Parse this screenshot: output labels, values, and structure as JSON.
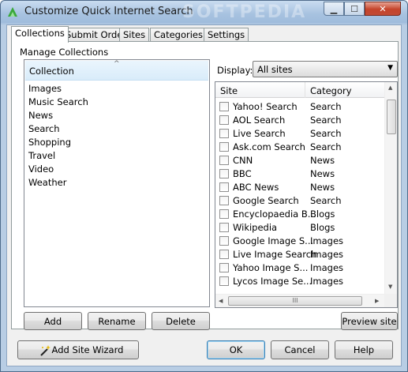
{
  "window": {
    "title": "Customize Quick Internet Search",
    "watermark": "SOFTPEDIA",
    "minimize_glyph": "▁",
    "maximize_glyph": "☐",
    "close_glyph": "✕"
  },
  "tabs": [
    {
      "label": "Collections",
      "active": true
    },
    {
      "label": "Submit Order",
      "active": false
    },
    {
      "label": "Sites",
      "active": false
    },
    {
      "label": "Categories",
      "active": false
    },
    {
      "label": "Settings",
      "active": false
    }
  ],
  "manage": {
    "group_label": "Manage Collections",
    "list_header": "Collection",
    "sort_glyph": "^",
    "collections": [
      "Images",
      "Music Search",
      "News",
      "Search",
      "Shopping",
      "Travel",
      "Video",
      "Weather"
    ],
    "buttons": {
      "add": "Add",
      "rename": "Rename",
      "delete": "Delete"
    }
  },
  "display": {
    "label": "Display:",
    "selected": "All sites",
    "arrow_glyph": "▼"
  },
  "sites": {
    "col_site": "Site",
    "col_category": "Category",
    "rows": [
      {
        "name": "Yahoo! Search",
        "category": "Search",
        "checked": false
      },
      {
        "name": "AOL Search",
        "category": "Search",
        "checked": false
      },
      {
        "name": "Live Search",
        "category": "Search",
        "checked": false
      },
      {
        "name": "Ask.com Search",
        "category": "Search",
        "checked": false
      },
      {
        "name": "CNN",
        "category": "News",
        "checked": false
      },
      {
        "name": "BBC",
        "category": "News",
        "checked": false
      },
      {
        "name": "ABC News",
        "category": "News",
        "checked": false
      },
      {
        "name": "Google Search",
        "category": "Search",
        "checked": false
      },
      {
        "name": "Encyclopaedia B...",
        "category": "Blogs",
        "checked": false
      },
      {
        "name": "Wikipedia",
        "category": "Blogs",
        "checked": false
      },
      {
        "name": "Google Image S...",
        "category": "Images",
        "checked": false
      },
      {
        "name": "Live Image Search",
        "category": "Images",
        "checked": false
      },
      {
        "name": "Yahoo Image S...",
        "category": "Images",
        "checked": false
      },
      {
        "name": "Lycos Image Se...",
        "category": "Images",
        "checked": false
      }
    ],
    "scroll_up": "▲",
    "scroll_down": "▼",
    "scroll_left": "◀",
    "scroll_right": "▶",
    "hthumb_grip": "III",
    "preview_button": "Preview site"
  },
  "footer": {
    "wizard_button": "Add Site Wizard",
    "ok": "OK",
    "cancel": "Cancel",
    "help": "Help"
  },
  "colors": {
    "accent": "#3c7fb1",
    "close_red": "#c5442b",
    "list_header": "#d9ecfa"
  }
}
